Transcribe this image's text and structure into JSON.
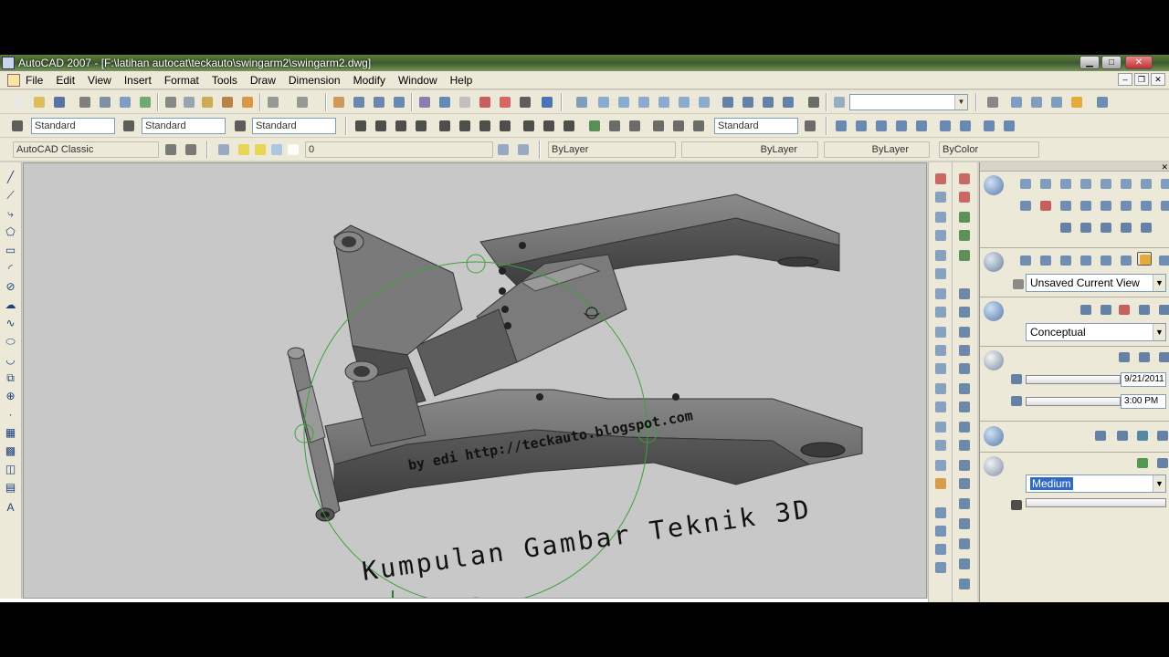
{
  "window": {
    "title": "AutoCAD 2007 - [F:\\latihan autocat\\teckauto\\swingarm2\\swingarm2.dwg]",
    "minimize": "▁",
    "maximize": "□",
    "close": "✕"
  },
  "menu": {
    "items": [
      "File",
      "Edit",
      "View",
      "Insert",
      "Format",
      "Tools",
      "Draw",
      "Dimension",
      "Modify",
      "Window",
      "Help"
    ],
    "mdi": [
      "–",
      "❐",
      "✕"
    ]
  },
  "toolbar1": {
    "ucs_combo": ""
  },
  "toolbar2": {
    "text_style": "Standard",
    "dim_style": "Standard",
    "table_style": "Standard",
    "mleader_style": "Standard"
  },
  "toolbar3": {
    "workspace": "AutoCAD Classic",
    "layer": "0",
    "color": "ByLayer",
    "linetype": "ByLayer",
    "lineweight": "ByLayer",
    "plotstyle": "ByColor"
  },
  "viewport": {
    "credit": "by edi http://teckauto.blogspot.com",
    "watermark": "Kumpulan Gambar Teknik 3D"
  },
  "dashboard": {
    "view_combo": "Unsaved Current View",
    "visual_style": "Conceptual",
    "date": "9/21/2011",
    "time": "3:00 PM",
    "render_preset": "Medium"
  },
  "colors": {
    "titlebar": "#3d5a2c",
    "chrome": "#ece9d8",
    "viewport_bg": "#c8c8c8",
    "orbit_ring": "#3ca03c",
    "model": "#6f6f6f"
  }
}
